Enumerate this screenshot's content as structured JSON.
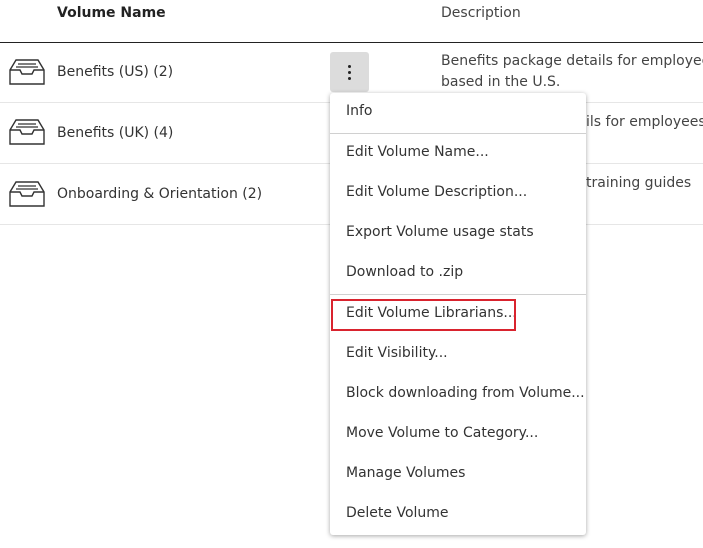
{
  "table": {
    "columns": {
      "name": "Volume Name",
      "description": "Description"
    },
    "rows": [
      {
        "name": "Benefits (US) (2)",
        "description_lines": [
          "Benefits package details for employees",
          "based in the U.S."
        ]
      },
      {
        "name": "Benefits (UK) (4)",
        "description_lines": [
          "ils for employees"
        ]
      },
      {
        "name": "Onboarding & Orientation (2)",
        "description_lines": [
          "training guides"
        ]
      }
    ]
  },
  "row_icon": "inbox-tray-icon",
  "actions_button_icon": "vertical-ellipsis-icon",
  "context_menu": {
    "items": [
      "Info",
      "Edit Volume Name...",
      "Edit Volume Description...",
      "Export Volume usage stats",
      "Download to .zip",
      "Edit Volume Librarians...",
      "Edit Visibility...",
      "Block downloading from Volume...",
      "Move Volume to Category...",
      "Manage Volumes",
      "Delete Volume"
    ],
    "highlighted_item": "Edit Volume Librarians..."
  },
  "colors": {
    "highlight": "#d9232e",
    "kebab_bg": "#dcdcdc",
    "divider": "#222222"
  }
}
